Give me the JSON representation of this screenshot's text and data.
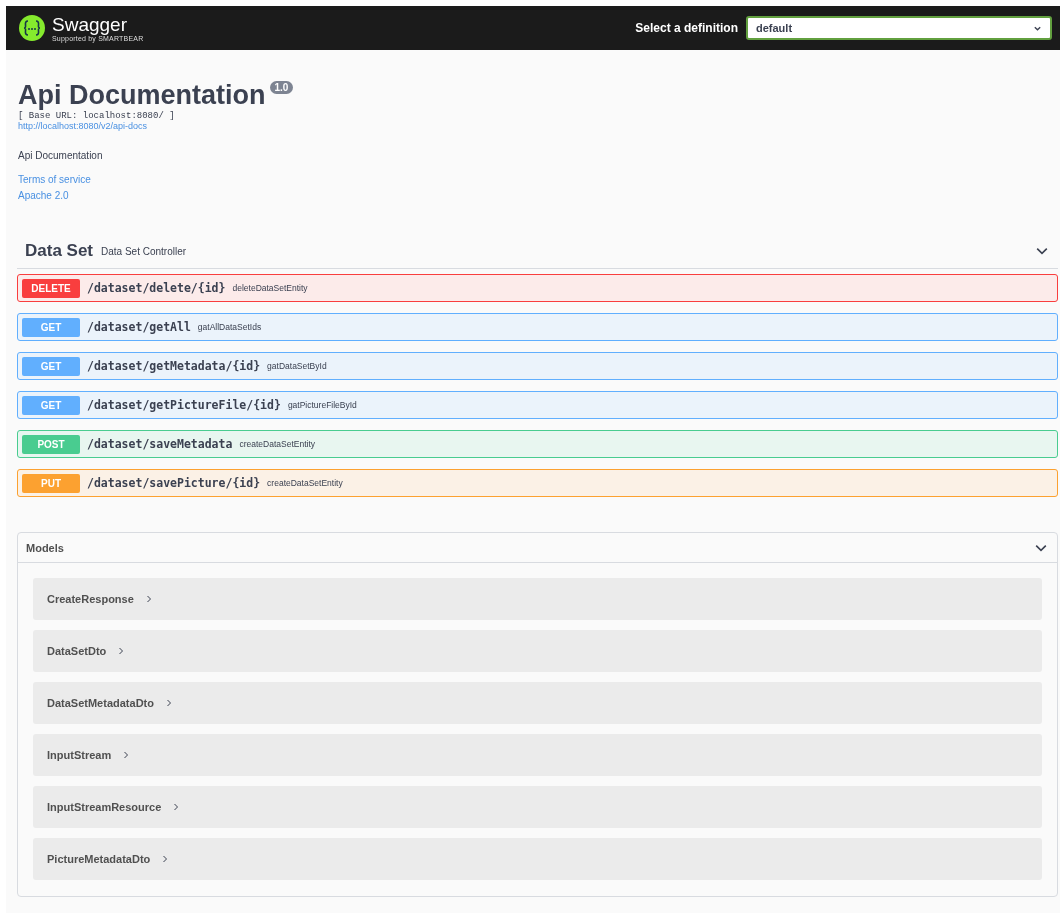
{
  "topbar": {
    "brand": "Swagger",
    "brand_sub": "Supported by SMARTBEAR",
    "definition_label": "Select a definition",
    "definition_value": "default"
  },
  "info": {
    "title": "Api Documentation",
    "version": "1.0",
    "base_url": "[ Base URL: localhost:8080/ ]",
    "docs_link": "http://localhost:8080/v2/api-docs",
    "description": "Api Documentation",
    "links": [
      "Terms of service",
      "Apache 2.0"
    ]
  },
  "tag": {
    "name": "Data Set",
    "description": "Data Set Controller",
    "expanded": true,
    "operations": [
      {
        "method": "DELETE",
        "kind": "delete",
        "path": "/dataset/delete/{id}",
        "summary": "deleteDataSetEntity"
      },
      {
        "method": "GET",
        "kind": "get",
        "path": "/dataset/getAll",
        "summary": "gatAllDataSetIds"
      },
      {
        "method": "GET",
        "kind": "get",
        "path": "/dataset/getMetadata/{id}",
        "summary": "gatDataSetById"
      },
      {
        "method": "GET",
        "kind": "get",
        "path": "/dataset/getPictureFile/{id}",
        "summary": "gatPictureFileById"
      },
      {
        "method": "POST",
        "kind": "post",
        "path": "/dataset/saveMetadata",
        "summary": "createDataSetEntity"
      },
      {
        "method": "PUT",
        "kind": "put",
        "path": "/dataset/savePicture/{id}",
        "summary": "createDataSetEntity"
      }
    ]
  },
  "models": {
    "title": "Models",
    "expanded": true,
    "items": [
      {
        "name": "CreateResponse",
        "expanded": false
      },
      {
        "name": "DataSetDto",
        "expanded": false
      },
      {
        "name": "DataSetMetadataDto",
        "expanded": false
      },
      {
        "name": "InputStream",
        "expanded": false
      },
      {
        "name": "InputStreamResource",
        "expanded": false
      },
      {
        "name": "PictureMetadataDto",
        "expanded": false
      }
    ]
  }
}
